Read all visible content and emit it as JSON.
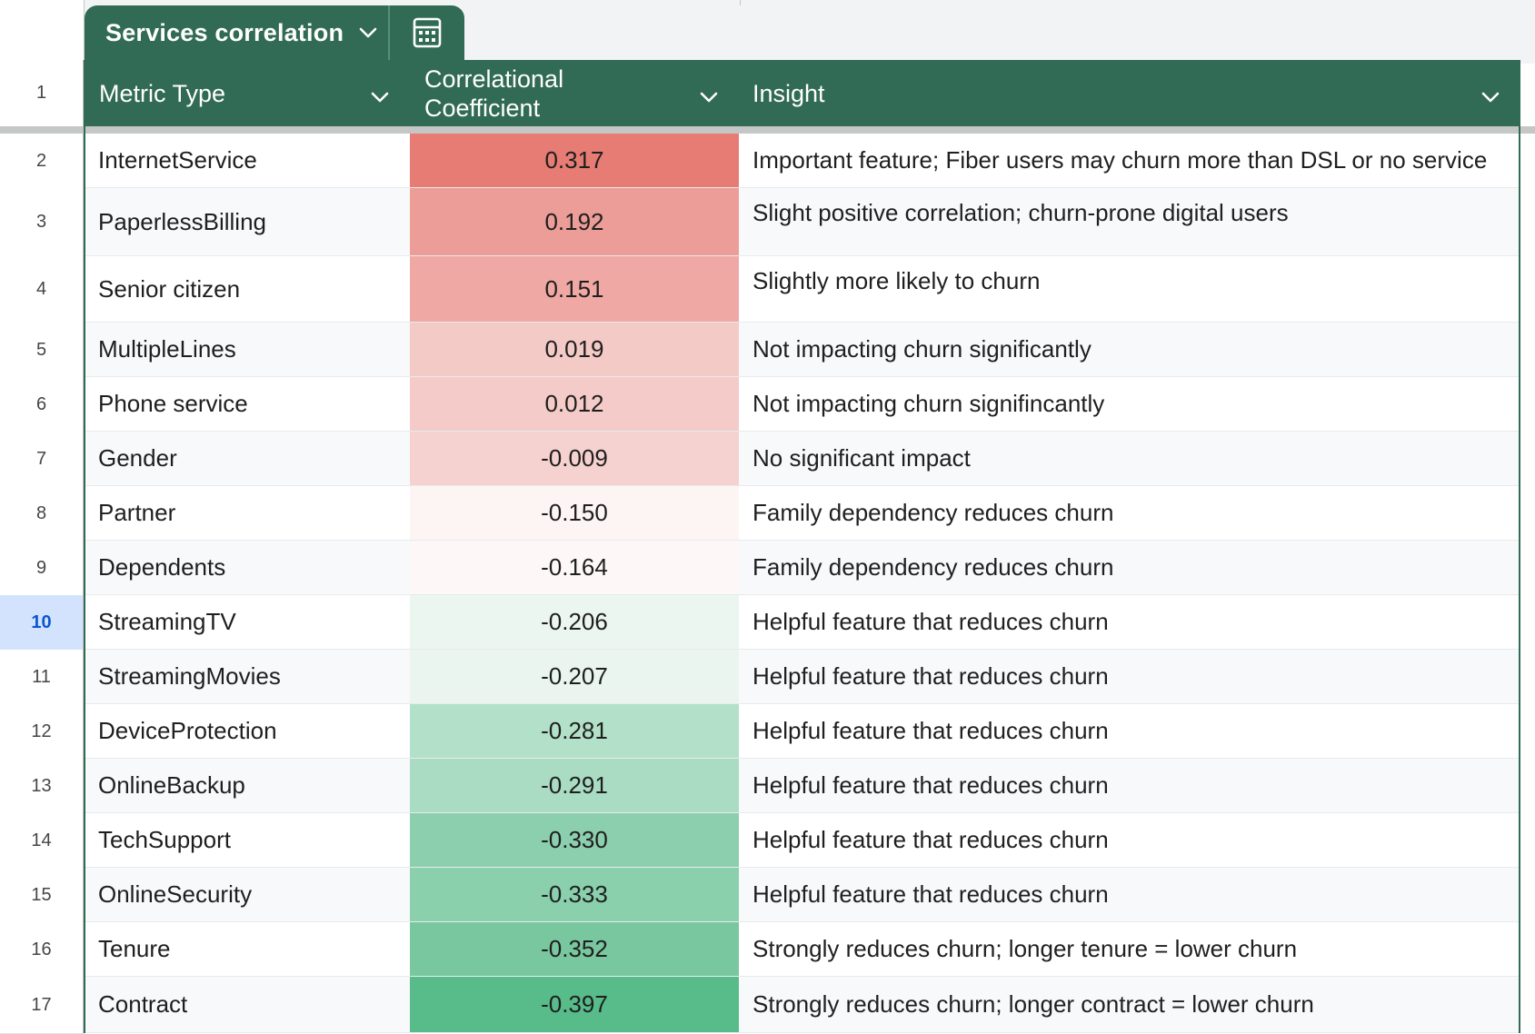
{
  "table": {
    "name": "Services correlation",
    "header_color": "#326b55",
    "columns": [
      {
        "label_lines": [
          "Metric Type"
        ]
      },
      {
        "label_lines": [
          "Correlational",
          "Coefficient"
        ]
      },
      {
        "label_lines": [
          "Insight"
        ]
      }
    ],
    "header_row_number": "1",
    "selected_row": "10",
    "rows": [
      {
        "num": "2",
        "metric": "InternetService",
        "coef": "0.317",
        "insight": "Important feature; Fiber users may churn more than DSL or no service",
        "color": "#e67c73"
      },
      {
        "num": "3",
        "metric": "PaperlessBilling",
        "coef": "0.192",
        "insight": "Slight positive correlation; churn-prone digital users",
        "color": "#ed9d97"
      },
      {
        "num": "4",
        "metric": "Senior citizen",
        "coef": "0.151",
        "insight": "Slightly more likely to churn",
        "color": "#efa8a3"
      },
      {
        "num": "5",
        "metric": "MultipleLines",
        "coef": "0.019",
        "insight": "Not impacting churn significantly",
        "color": "#f4cac7"
      },
      {
        "num": "6",
        "metric": "Phone service",
        "coef": "0.012",
        "insight": "Not impacting churn signifincantly",
        "color": "#f4cbc8"
      },
      {
        "num": "7",
        "metric": "Gender",
        "coef": "-0.009",
        "insight": "No significant impact",
        "color": "#f5d1cf"
      },
      {
        "num": "8",
        "metric": "Partner",
        "coef": "-0.150",
        "insight": "Family dependency reduces churn",
        "color": "#fdf5f4"
      },
      {
        "num": "9",
        "metric": "Dependents",
        "coef": "-0.164",
        "insight": "Family dependency reduces churn",
        "color": "#fdf8f7"
      },
      {
        "num": "10",
        "metric": "StreamingTV",
        "coef": "-0.206",
        "insight": "Helpful feature that reduces churn",
        "color": "#ecf6f0"
      },
      {
        "num": "11",
        "metric": "StreamingMovies",
        "coef": "-0.207",
        "insight": "Helpful feature that reduces churn",
        "color": "#ebf5ef"
      },
      {
        "num": "12",
        "metric": "DeviceProtection",
        "coef": "-0.281",
        "insight": "Helpful feature that reduces churn",
        "color": "#b3e0c9"
      },
      {
        "num": "13",
        "metric": "OnlineBackup",
        "coef": "-0.291",
        "insight": "Helpful feature that reduces churn",
        "color": "#a9dcc2"
      },
      {
        "num": "14",
        "metric": "TechSupport",
        "coef": "-0.330",
        "insight": "Helpful feature that reduces churn",
        "color": "#8ccfae"
      },
      {
        "num": "15",
        "metric": "OnlineSecurity",
        "coef": "-0.333",
        "insight": "Helpful feature that reduces churn",
        "color": "#8ad0ad"
      },
      {
        "num": "16",
        "metric": "Tenure",
        "coef": "-0.352",
        "insight": "Strongly reduces churn; longer tenure = lower churn",
        "color": "#78c79f"
      },
      {
        "num": "17",
        "metric": "Contract",
        "coef": "-0.397",
        "insight": "Strongly reduces churn; longer contract = lower churn",
        "color": "#57bb8a"
      }
    ]
  },
  "icons": {
    "tab_menu": "chevron-down-icon",
    "tab_action": "calculator-icon",
    "column_filter": "chevron-down-icon"
  }
}
